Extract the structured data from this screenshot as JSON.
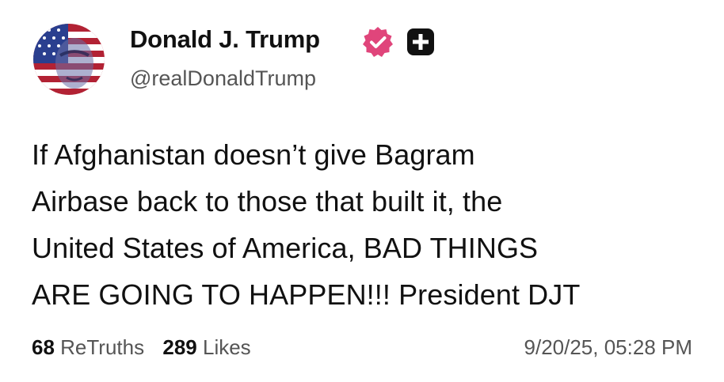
{
  "profile": {
    "display_name": "Donald J. Trump",
    "handle": "@realDonaldTrump",
    "verified_icon": "verified-badge-icon",
    "plus_icon": "plus-badge-icon",
    "verified_color": "#e0457b"
  },
  "post": {
    "lines": [
      "If Afghanistan doesn’t give Bagram",
      "Airbase back to those that built it, the",
      "United States of America, BAD THINGS",
      "ARE GOING TO HAPPEN!!! President DJT"
    ]
  },
  "stats": {
    "retruths_count": "68",
    "retruths_label": "ReTruths",
    "likes_count": "289",
    "likes_label": "Likes"
  },
  "timestamp": "9/20/25, 05:28 PM"
}
